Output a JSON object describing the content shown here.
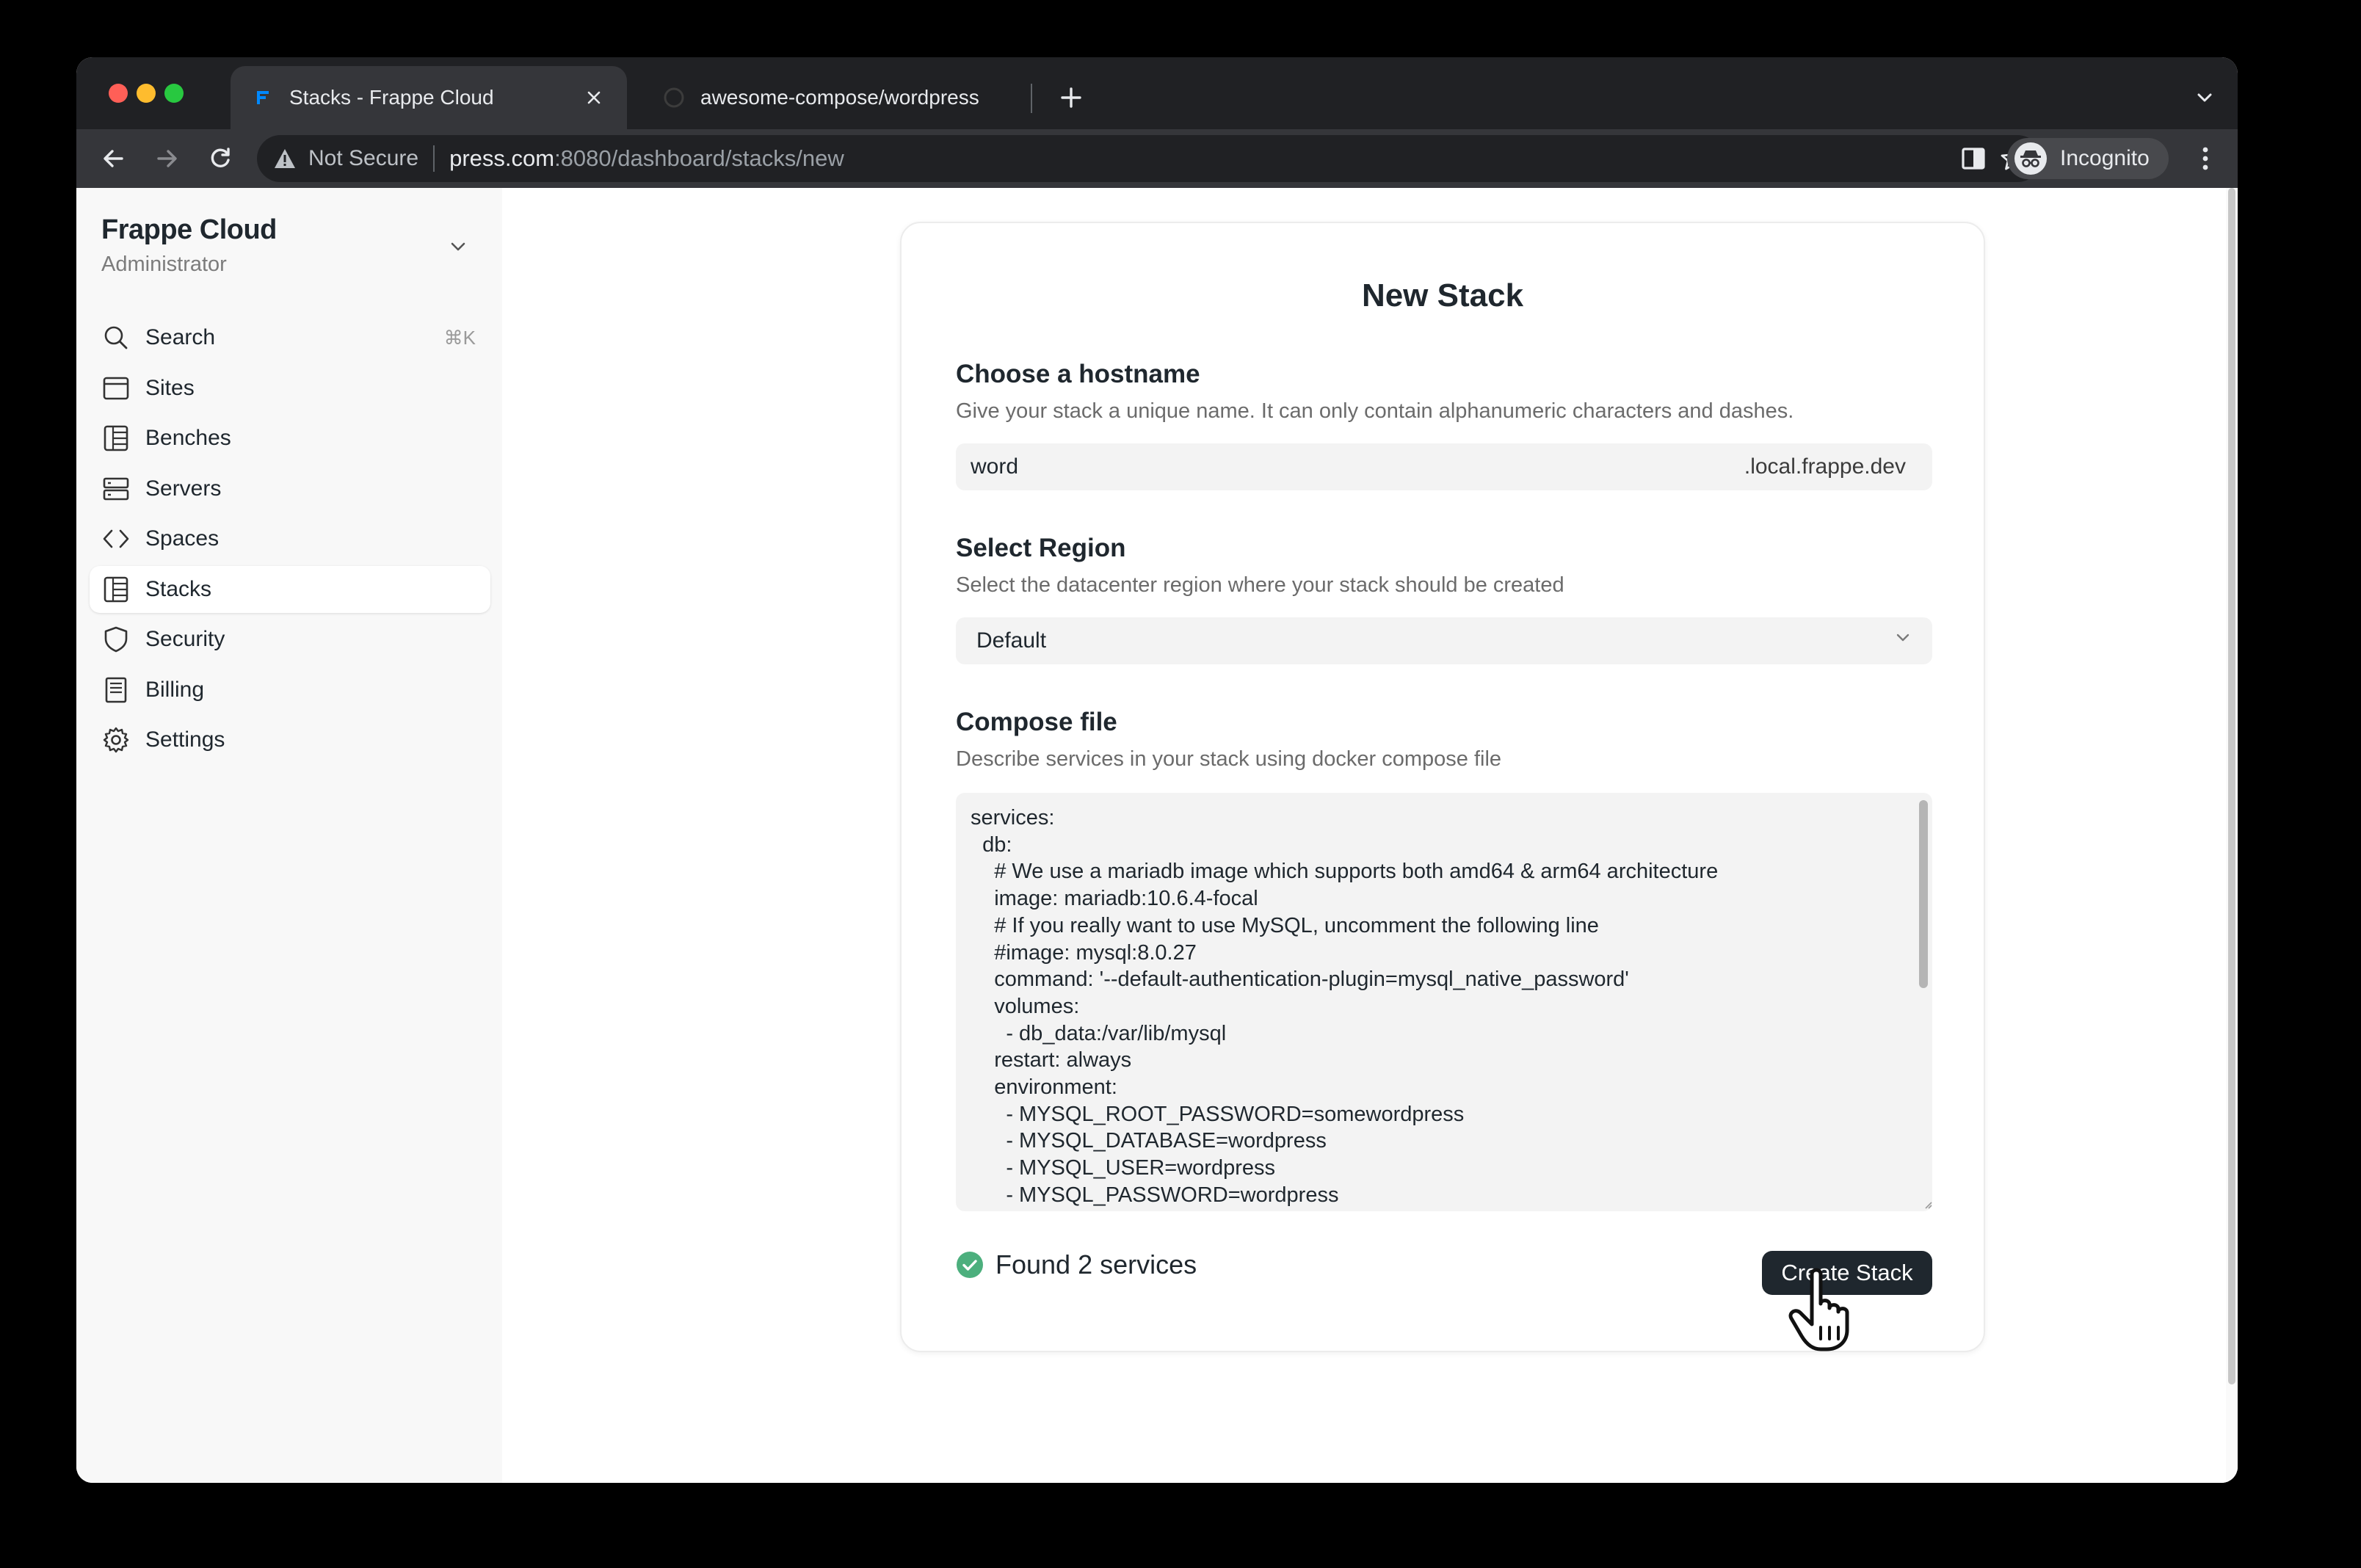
{
  "browser": {
    "tabs": [
      {
        "title": "Stacks - Frappe Cloud",
        "active": true
      },
      {
        "title": "awesome-compose/wordpress",
        "active": false
      }
    ],
    "address": {
      "security_label": "Not Secure",
      "host": "press.com",
      "rest": ":8080/dashboard/stacks/new"
    },
    "profile_label": "Incognito"
  },
  "sidebar": {
    "brand": "Frappe Cloud",
    "role": "Administrator",
    "items": [
      {
        "label": "Search",
        "shortcut": "⌘K",
        "icon": "search-icon"
      },
      {
        "label": "Sites",
        "icon": "browser-icon"
      },
      {
        "label": "Benches",
        "icon": "grid-icon"
      },
      {
        "label": "Servers",
        "icon": "server-icon"
      },
      {
        "label": "Spaces",
        "icon": "code-icon"
      },
      {
        "label": "Stacks",
        "icon": "grid-icon",
        "active": true
      },
      {
        "label": "Security",
        "icon": "shield-icon"
      },
      {
        "label": "Billing",
        "icon": "receipt-icon"
      },
      {
        "label": "Settings",
        "icon": "gear-icon"
      }
    ]
  },
  "form": {
    "title": "New Stack",
    "hostname": {
      "label": "Choose a hostname",
      "description": "Give your stack a unique name. It can only contain alphanumeric characters and dashes.",
      "value": "word",
      "suffix": ".local.frappe.dev"
    },
    "region": {
      "label": "Select Region",
      "description": "Select the datacenter region where your stack should be created",
      "selected": "Default"
    },
    "compose": {
      "label": "Compose file",
      "description": "Describe services in your stack using docker compose file",
      "content": "services:\n  db:\n    # We use a mariadb image which supports both amd64 & arm64 architecture\n    image: mariadb:10.6.4-focal\n    # If you really want to use MySQL, uncomment the following line\n    #image: mysql:8.0.27\n    command: '--default-authentication-plugin=mysql_native_password'\n    volumes:\n      - db_data:/var/lib/mysql\n    restart: always\n    environment:\n      - MYSQL_ROOT_PASSWORD=somewordpress\n      - MYSQL_DATABASE=wordpress\n      - MYSQL_USER=wordpress\n      - MYSQL_PASSWORD=wordpress"
    },
    "status_text": "Found 2 services",
    "submit_label": "Create Stack"
  },
  "colors": {
    "success": "#4caf7d",
    "primary_button": "#1f272e"
  }
}
